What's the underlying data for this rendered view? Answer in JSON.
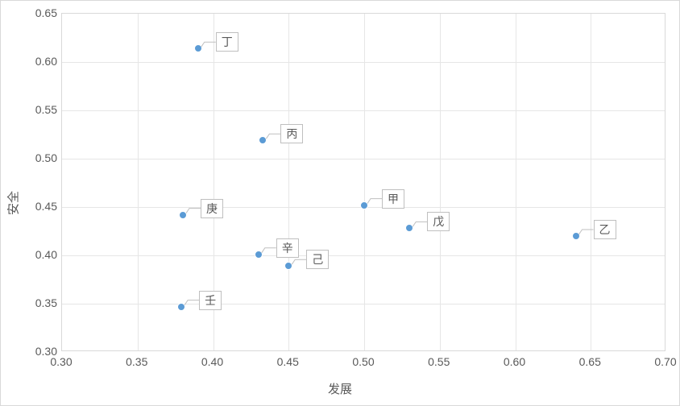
{
  "chart_data": {
    "type": "scatter",
    "xlabel": "发展",
    "ylabel": "安全",
    "xlim": [
      0.3,
      0.7
    ],
    "ylim": [
      0.3,
      0.65
    ],
    "xticks": [
      0.3,
      0.35,
      0.4,
      0.45,
      0.5,
      0.55,
      0.6,
      0.65,
      0.7
    ],
    "yticks": [
      0.3,
      0.35,
      0.4,
      0.45,
      0.5,
      0.55,
      0.6,
      0.65
    ],
    "points": [
      {
        "label": "甲",
        "x": 0.5,
        "y": 0.452
      },
      {
        "label": "乙",
        "x": 0.64,
        "y": 0.42
      },
      {
        "label": "丙",
        "x": 0.433,
        "y": 0.519
      },
      {
        "label": "丁",
        "x": 0.39,
        "y": 0.614
      },
      {
        "label": "戊",
        "x": 0.53,
        "y": 0.428
      },
      {
        "label": "己",
        "x": 0.45,
        "y": 0.389
      },
      {
        "label": "庚",
        "x": 0.38,
        "y": 0.442
      },
      {
        "label": "辛",
        "x": 0.43,
        "y": 0.401
      },
      {
        "label": "壬",
        "x": 0.379,
        "y": 0.347
      }
    ]
  }
}
